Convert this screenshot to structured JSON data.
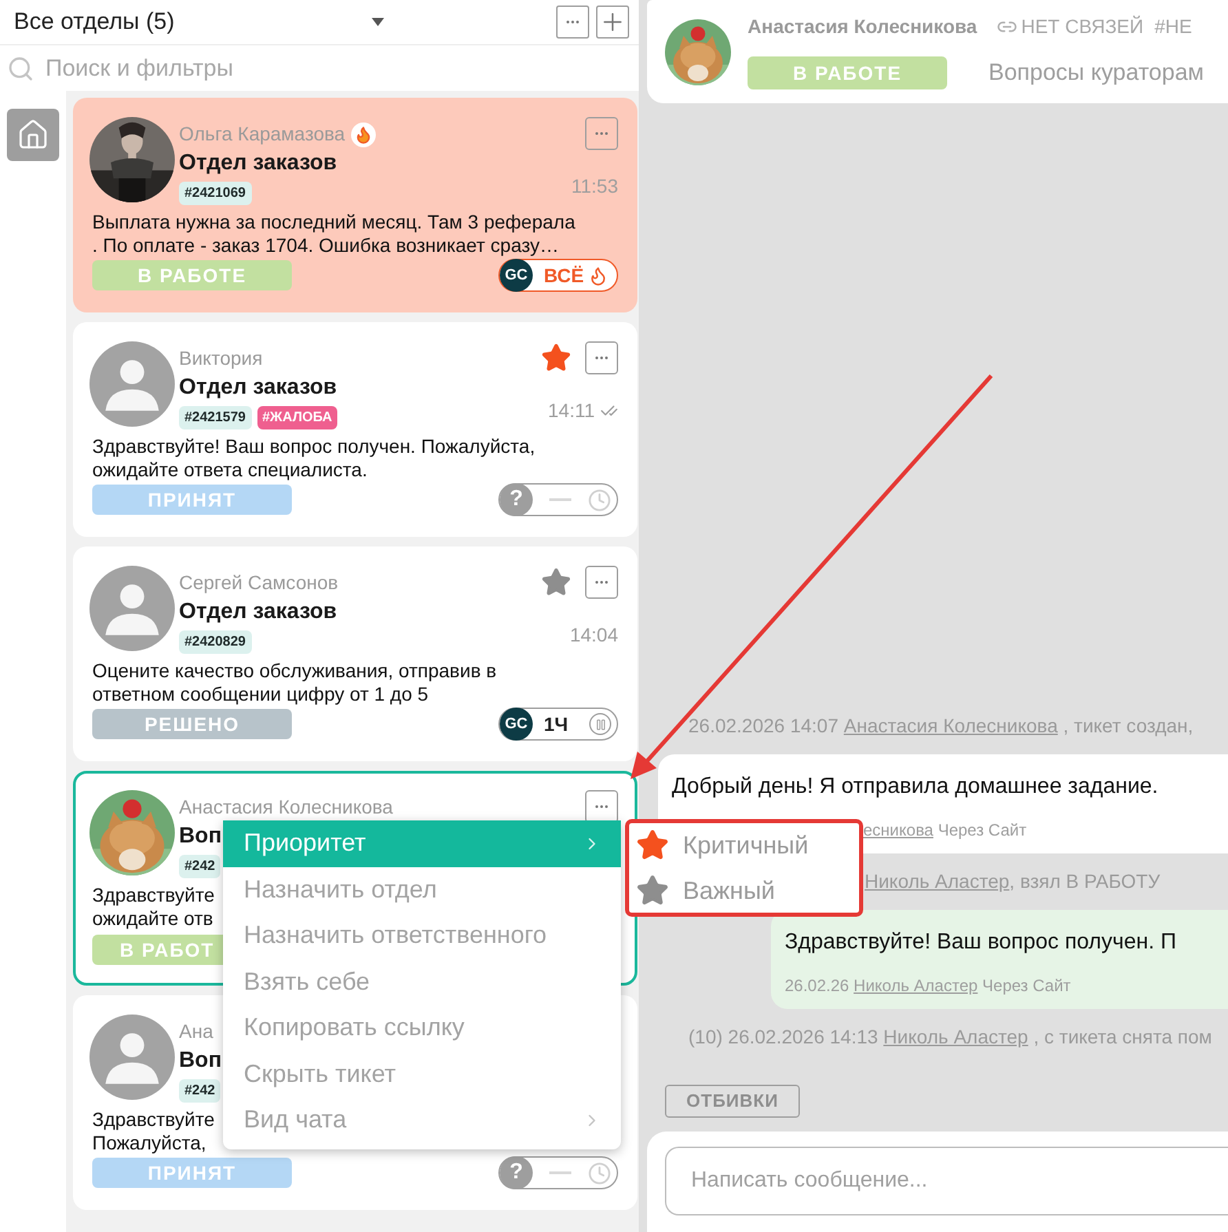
{
  "sidebar": {
    "title": "Все отделы (5)",
    "search": {
      "placeholder": "Поиск и фильтры"
    }
  },
  "tickets": [
    {
      "name": "Ольга Карамазова",
      "hot": true,
      "avatar": {
        "kind": "picture"
      },
      "department": "Отдел заказов",
      "tags": [
        {
          "text": "#2421069",
          "kind": "id"
        }
      ],
      "time": "11:53",
      "delivered": false,
      "menu_button": true,
      "selected": false,
      "highlighted": true,
      "message": [
        "Выплата нужна за последний месяц. Там 3 реферала",
        ". По оплате - заказ 1704. Ошибка возникает сразу…"
      ],
      "status": {
        "label": "В РАБОТЕ",
        "kind": "work"
      },
      "widget": {
        "kind": "gc_hot",
        "logo": "GC",
        "text": "ВСЁ"
      }
    },
    {
      "name": "Виктория",
      "hot": false,
      "avatar": {
        "kind": "default"
      },
      "department": "Отдел заказов",
      "tags": [
        {
          "text": "#2421579",
          "kind": "id"
        },
        {
          "text": "#ЖАЛОБА",
          "kind": "complaint"
        }
      ],
      "time": "14:11",
      "delivered": true,
      "star": {
        "kind": "critical"
      },
      "menu_button": true,
      "selected": false,
      "highlighted": false,
      "message": [
        "Здравствуйте! Ваш вопрос получен. Пожалуйста,",
        "ожидайте ответа специалиста."
      ],
      "status": {
        "label": "ПРИНЯТ",
        "kind": "accepted"
      },
      "widget": {
        "kind": "unassigned",
        "symbol": "?"
      }
    },
    {
      "name": "Сергей Самсонов",
      "hot": false,
      "avatar": {
        "kind": "default"
      },
      "department": "Отдел заказов",
      "tags": [
        {
          "text": "#2420829",
          "kind": "id"
        }
      ],
      "time": "14:04",
      "delivered": false,
      "star": {
        "kind": "important"
      },
      "menu_button": true,
      "selected": false,
      "highlighted": false,
      "message": [
        "Оцените качество обслуживания, отправив в",
        "ответном сообщении цифру от 1 до 5"
      ],
      "status": {
        "label": "РЕШЕНО",
        "kind": "solved"
      },
      "widget": {
        "kind": "gc_paused",
        "logo": "GC",
        "text": "1Ч"
      }
    },
    {
      "name": "Анастасия Колесникова",
      "hot": false,
      "avatar": {
        "kind": "picture"
      },
      "department": "Воп",
      "tags": [
        {
          "text": "#242",
          "kind": "id"
        }
      ],
      "menu_button": true,
      "selected": true,
      "highlighted": false,
      "message": [
        "Здравствуйте",
        "ожидайте отв"
      ],
      "status": {
        "label": "В РАБОТ",
        "kind": "work"
      }
    },
    {
      "name": "Ана",
      "avatar": {
        "kind": "default"
      },
      "department": "Воп",
      "tags": [
        {
          "text": "#242",
          "kind": "id"
        }
      ],
      "selected": false,
      "highlighted": false,
      "message": [
        "Здравствуйте",
        "Пожалуйста,"
      ],
      "status": {
        "label": "ПРИНЯТ",
        "kind": "accepted"
      },
      "widget": {
        "kind": "unassigned",
        "symbol": "?"
      }
    }
  ],
  "context_menu": {
    "items": [
      {
        "label": "Приоритет",
        "selected": true,
        "submenu": true
      },
      {
        "label": "Назначить отдел",
        "selected": false,
        "submenu": false
      },
      {
        "label": "Назначить ответственного",
        "selected": false,
        "submenu": false
      },
      {
        "label": "Взять себе",
        "selected": false,
        "submenu": false
      },
      {
        "label": "Копировать ссылку",
        "selected": false,
        "submenu": false
      },
      {
        "label": "Скрыть тикет",
        "selected": false,
        "submenu": false
      },
      {
        "label": "Вид чата",
        "selected": false,
        "submenu": true
      }
    ],
    "submenu": [
      {
        "label": "Критичный",
        "kind": "critical"
      },
      {
        "label": "Важный",
        "kind": "important"
      }
    ]
  },
  "chat": {
    "header": {
      "name": "Анастасия Колесникова",
      "links": "НЕТ СВЯЗЕЙ",
      "tag": "#НЕ",
      "status": {
        "label": "В РАБОТЕ",
        "kind": "work"
      },
      "department": "Вопросы кураторам"
    },
    "events": [
      {
        "kind": "system",
        "covered": false,
        "prefix": "26.02.2026 14:07",
        "author": "Анастасия Колесникова",
        "suffix": " , тикет создан,"
      },
      {
        "kind": "incoming",
        "covered": true,
        "text": "Добрый день! Я отправила домашнее задание.",
        "author": "есникова",
        "via": "Через Сайт"
      },
      {
        "kind": "system",
        "covered": true,
        "author": "Николь Аластер",
        "suffix": ", взял В РАБОТУ"
      },
      {
        "kind": "outgoing",
        "covered": false,
        "text": "Здравствуйте! Ваш вопрос получен. П",
        "date": "26.02.26",
        "author": "Николь Аластер",
        "via": "Через Сайт"
      },
      {
        "kind": "system",
        "covered": false,
        "prefix": "(10) 26.02.2026 14:13",
        "author": "Николь Аластер",
        "suffix": " , с тикета снята пом"
      }
    ],
    "templates_button": "ОТБИВКИ",
    "composer": {
      "placeholder": "Написать сообщение..."
    }
  }
}
